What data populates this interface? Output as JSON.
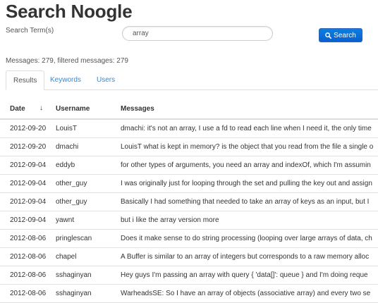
{
  "app": {
    "title": "Search Noogle"
  },
  "search": {
    "label": "Search Term(s)",
    "value": "array",
    "button_label": "Search"
  },
  "status": {
    "counts": "Messages: 279, filtered messages: 279"
  },
  "tabs": [
    {
      "label": "Results",
      "active": true
    },
    {
      "label": "Keywords",
      "active": false
    },
    {
      "label": "Users",
      "active": false
    }
  ],
  "table": {
    "headers": {
      "date": "Date",
      "username": "Username",
      "messages": "Messages"
    },
    "sort_indicator": "↓",
    "rows": [
      {
        "date": "2012-09-20",
        "user": "LouisT",
        "message": "dmachi: it's not an array, I use a fd to read each line when I need it, the only time"
      },
      {
        "date": "2012-09-20",
        "user": "dmachi",
        "message": "LouisT what is kept in memory? is the object that you read from the file a single o"
      },
      {
        "date": "2012-09-04",
        "user": "eddyb",
        "message": "for other types of arguments, you need an array and indexOf, which I'm assumin"
      },
      {
        "date": "2012-09-04",
        "user": "other_guy",
        "message": "I was originally just for looping through the set and pulling the key out and assign"
      },
      {
        "date": "2012-09-04",
        "user": "other_guy",
        "message": "Basically I had something that needed to take an array of keys as an input, but I"
      },
      {
        "date": "2012-09-04",
        "user": "yawnt",
        "message": "but i like the array version more"
      },
      {
        "date": "2012-08-06",
        "user": "pringlescan",
        "message": "Does it make sense to do string processing (looping over large arrays of data, ch"
      },
      {
        "date": "2012-08-06",
        "user": "chapel",
        "message": "A Buffer is similar to an array of integers but corresponds to a raw memory alloc"
      },
      {
        "date": "2012-08-06",
        "user": "sshaginyan",
        "message": "Hey guys I'm passing an array with query { 'data[]': queue } and I'm doing reque"
      },
      {
        "date": "2012-08-06",
        "user": "sshaginyan",
        "message": "WarheadsSE: So I have an array of objects (associative array) and every two se"
      }
    ]
  },
  "colors": {
    "button_bg": "#0b6fd6",
    "link": "#3a87cf",
    "text": "#333333"
  },
  "icons": {
    "search_button": "magnifier-icon"
  }
}
